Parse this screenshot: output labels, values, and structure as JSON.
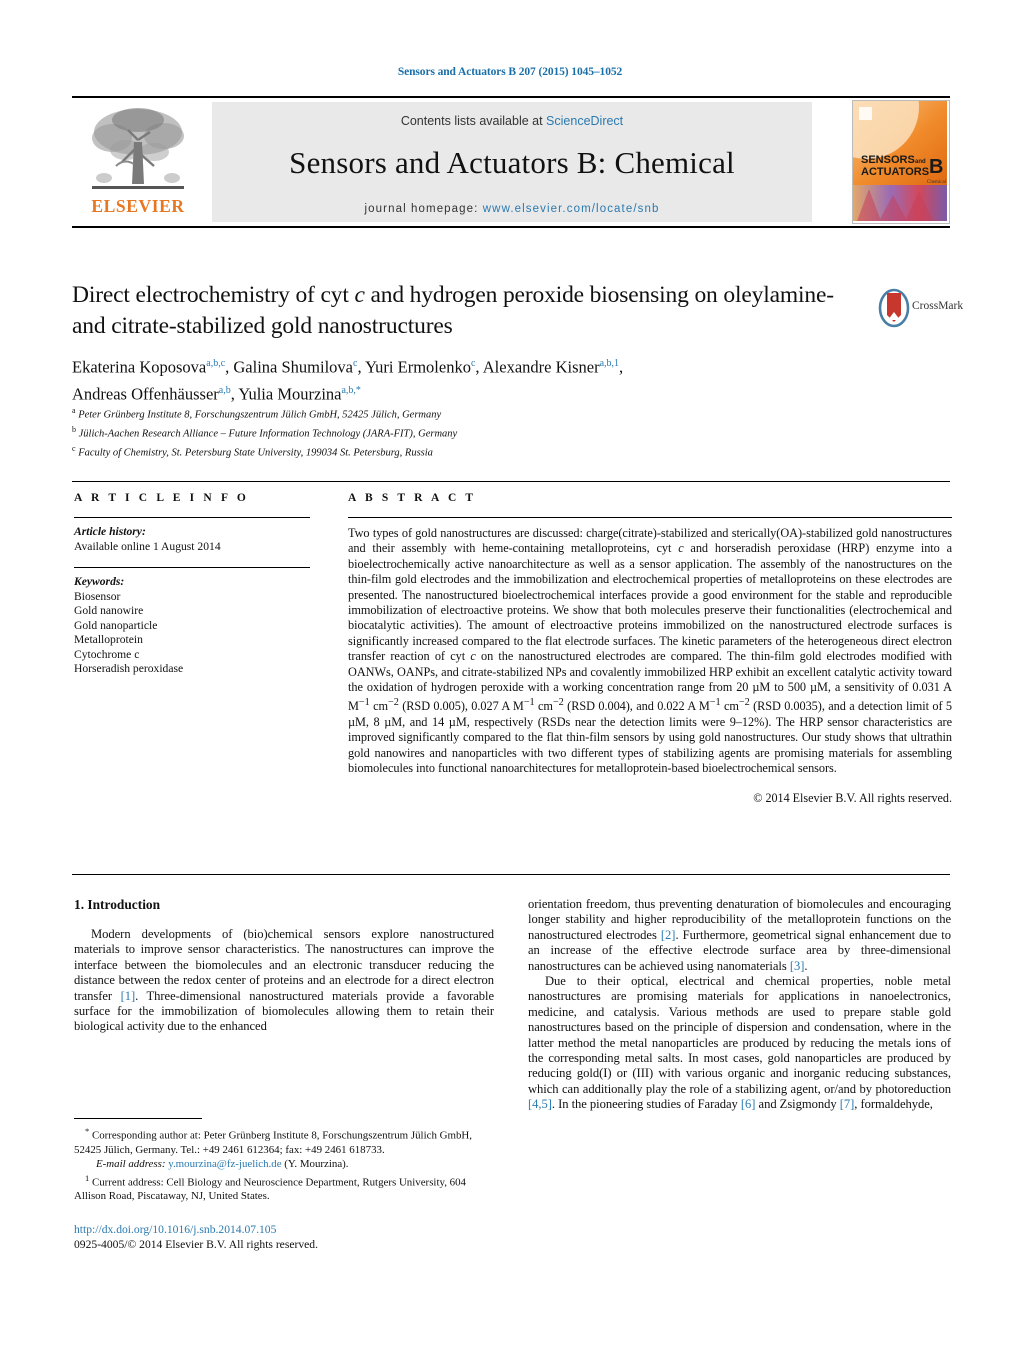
{
  "running_head": "Sensors and Actuators B 207 (2015) 1045–1052",
  "masthead": {
    "contents_prefix": "Contents lists available at ",
    "contents_link": "ScienceDirect",
    "journal_title": "Sensors and Actuators B: Chemical",
    "homepage_prefix": "journal homepage: ",
    "homepage_link": "www.elsevier.com/locate/snb",
    "publisher_wordmark": "ELSEVIER",
    "cover_title_line1": "SENSORS",
    "cover_title_and": "and",
    "cover_title_line2": "ACTUATORS",
    "cover_letter": "B",
    "cover_sub": "Chemical",
    "accent_link_color": "#2a7ab0",
    "elsevier_orange": "#E87722"
  },
  "article": {
    "title_part1": "Direct electrochemistry of cyt ",
    "title_italic": "c",
    "title_part2": " and hydrogen peroxide biosensing on oleylamine- and citrate-stabilized gold nanostructures",
    "crossmark_label": "CrossMark",
    "authors_html": "Ekaterina Koposova, Galina Shumilova, Yuri Ermolenko, Alexandre Kisner, Andreas Offenhäusser, Yulia Mourzina",
    "author_list": [
      {
        "name": "Ekaterina Koposova",
        "marks": "a,b,c"
      },
      {
        "name": "Galina Shumilova",
        "marks": "c"
      },
      {
        "name": "Yuri Ermolenko",
        "marks": "c"
      },
      {
        "name": "Alexandre Kisner",
        "marks": "a,b,1"
      },
      {
        "name": "Andreas Offenhäusser",
        "marks": "a,b"
      },
      {
        "name": "Yulia Mourzina",
        "marks": "a,b,*"
      }
    ],
    "affiliations": [
      {
        "mark": "a",
        "text": "Peter Grünberg Institute 8, Forschungszentrum Jülich GmbH, 52425 Jülich, Germany"
      },
      {
        "mark": "b",
        "text": "Jülich-Aachen Research Alliance – Future Information Technology (JARA-FIT), Germany"
      },
      {
        "mark": "c",
        "text": "Faculty of Chemistry, St. Petersburg State University, 199034 St. Petersburg, Russia"
      }
    ]
  },
  "article_info": {
    "heading": "A R T I C L E    I N F O",
    "history_label": "Article history:",
    "history_value": "Available online 1 August 2014",
    "keywords_label": "Keywords:",
    "keywords": [
      "Biosensor",
      "Gold nanowire",
      "Gold nanoparticle",
      "Metalloprotein",
      "Cytochrome c",
      "Horseradish peroxidase"
    ]
  },
  "abstract": {
    "heading": "A B S T R A C T",
    "paragraph_1": "Two types of gold nanostructures are discussed: charge(citrate)-stabilized and sterically(OA)-stabilized gold nanostructures and their assembly with heme-containing metalloproteins, cyt ",
    "paragraph_1b": " and horseradish peroxidase (HRP) enzyme into a bioelectrochemically active nanoarchitecture as well as a sensor application. The assembly of the nanostructures on the thin-film gold electrodes and the immobilization and electrochemical properties of metalloproteins on these electrodes are presented. The nanostructured bioelectrochemical interfaces provide a good environment for the stable and reproducible immobilization of electroactive proteins. We show that both molecules preserve their functionalities (electrochemical and biocatalytic activities). The amount of electroactive proteins immobilized on the nanostructured electrode surfaces is significantly increased compared to the flat electrode surfaces. The kinetic parameters of the heterogeneous direct electron transfer reaction of cyt ",
    "paragraph_1c": " on the nanostructured electrodes are compared. The thin-film gold electrodes modified with OANWs, OANPs, and citrate-stabilized NPs and covalently immobilized HRP exhibit an excellent catalytic activity toward the oxidation of hydrogen peroxide with a working concentration range from 20 µM to 500 µM, a sensitivity of 0.031 A M",
    "paragraph_1d": " cm",
    "paragraph_1e": " (RSD 0.005), 0.027 A M",
    "paragraph_1f": " cm",
    "paragraph_1g": " (RSD 0.004), and 0.022 A M",
    "paragraph_1h": " cm",
    "paragraph_1i": " (RSD 0.0035), and a detection limit of 5 µM, 8 µM, and 14 µM, respectively (RSDs near the detection limits were 9–12%). The HRP sensor characteristics are improved significantly compared to the flat thin-film sensors by using gold nanostructures. Our study shows that ultrathin gold nanowires and nanoparticles with two different types of stabilizing agents are promising materials for assembling biomolecules into functional nanoarchitectures for metalloprotein-based bioelectrochemical sensors.",
    "sup_minus1": "−1",
    "sup_minus2": "−2",
    "italic_c": "c",
    "copyright": "© 2014 Elsevier B.V. All rights reserved."
  },
  "introduction": {
    "heading": "1.  Introduction",
    "left_p1_a": "Modern developments of (bio)chemical sensors explore nanostructured materials to improve sensor characteristics. The nanostructures can improve the interface between the biomolecules and an electronic transducer reducing the distance between the redox center of proteins and an electrode for a direct electron transfer ",
    "left_p1_ref": "[1]",
    "left_p1_b": ". Three-dimensional nanostructured materials provide a favorable surface for the immobilization of biomolecules allowing them to retain their biological activity due to the enhanced",
    "right_p1_a": "orientation freedom, thus preventing denaturation of biomolecules and encouraging longer stability and higher reproducibility of the metalloprotein functions on the nanostructured electrodes ",
    "right_p1_ref": "[2]",
    "right_p1_b": ". Furthermore, geometrical signal enhancement due to an increase of the effective electrode surface area by three-dimensional nanostructures can be achieved using nanomaterials ",
    "right_p1_ref2": "[3]",
    "right_p1_c": ".",
    "right_p2_a": "Due to their optical, electrical and chemical properties, noble metal nanostructures are promising materials for applications in nanoelectronics, medicine, and catalysis. Various methods are used to prepare stable gold nanostructures based on the principle of dispersion and condensation, where in the latter method the metal nanoparticles are produced by reducing the metals ions of the corresponding metal salts. In most cases, gold nanoparticles are produced by reducing gold(I) or (III) with various organic and inorganic reducing substances, which can additionally play the role of a stabilizing agent, or/and by photoreduction ",
    "right_p2_ref": "[4,5]",
    "right_p2_b": ". In the pioneering studies of Faraday ",
    "right_p2_ref2": "[6]",
    "right_p2_c": " and Zsigmondy ",
    "right_p2_ref3": "[7]",
    "right_p2_d": ", formaldehyde,"
  },
  "footnotes": {
    "corresponding_star": "*",
    "corresponding_text": " Corresponding author at: Peter Grünberg Institute 8, Forschungszentrum Jülich GmbH, 52425 Jülich, Germany. Tel.: +49 2461 612364; fax: +49 2461 618733.",
    "email_label": "E-mail address:",
    "email_link": "y.mourzina@fz-juelich.de",
    "email_suffix": " (Y. Mourzina).",
    "current_address_mark": "1",
    "current_address_text": " Current address: Cell Biology and Neuroscience Department, Rutgers University, 604 Allison Road, Piscataway, NJ, United States.",
    "doi_link": "http://dx.doi.org/10.1016/j.snb.2014.07.105",
    "issn_line": "0925-4005/© 2014 Elsevier B.V. All rights reserved."
  }
}
